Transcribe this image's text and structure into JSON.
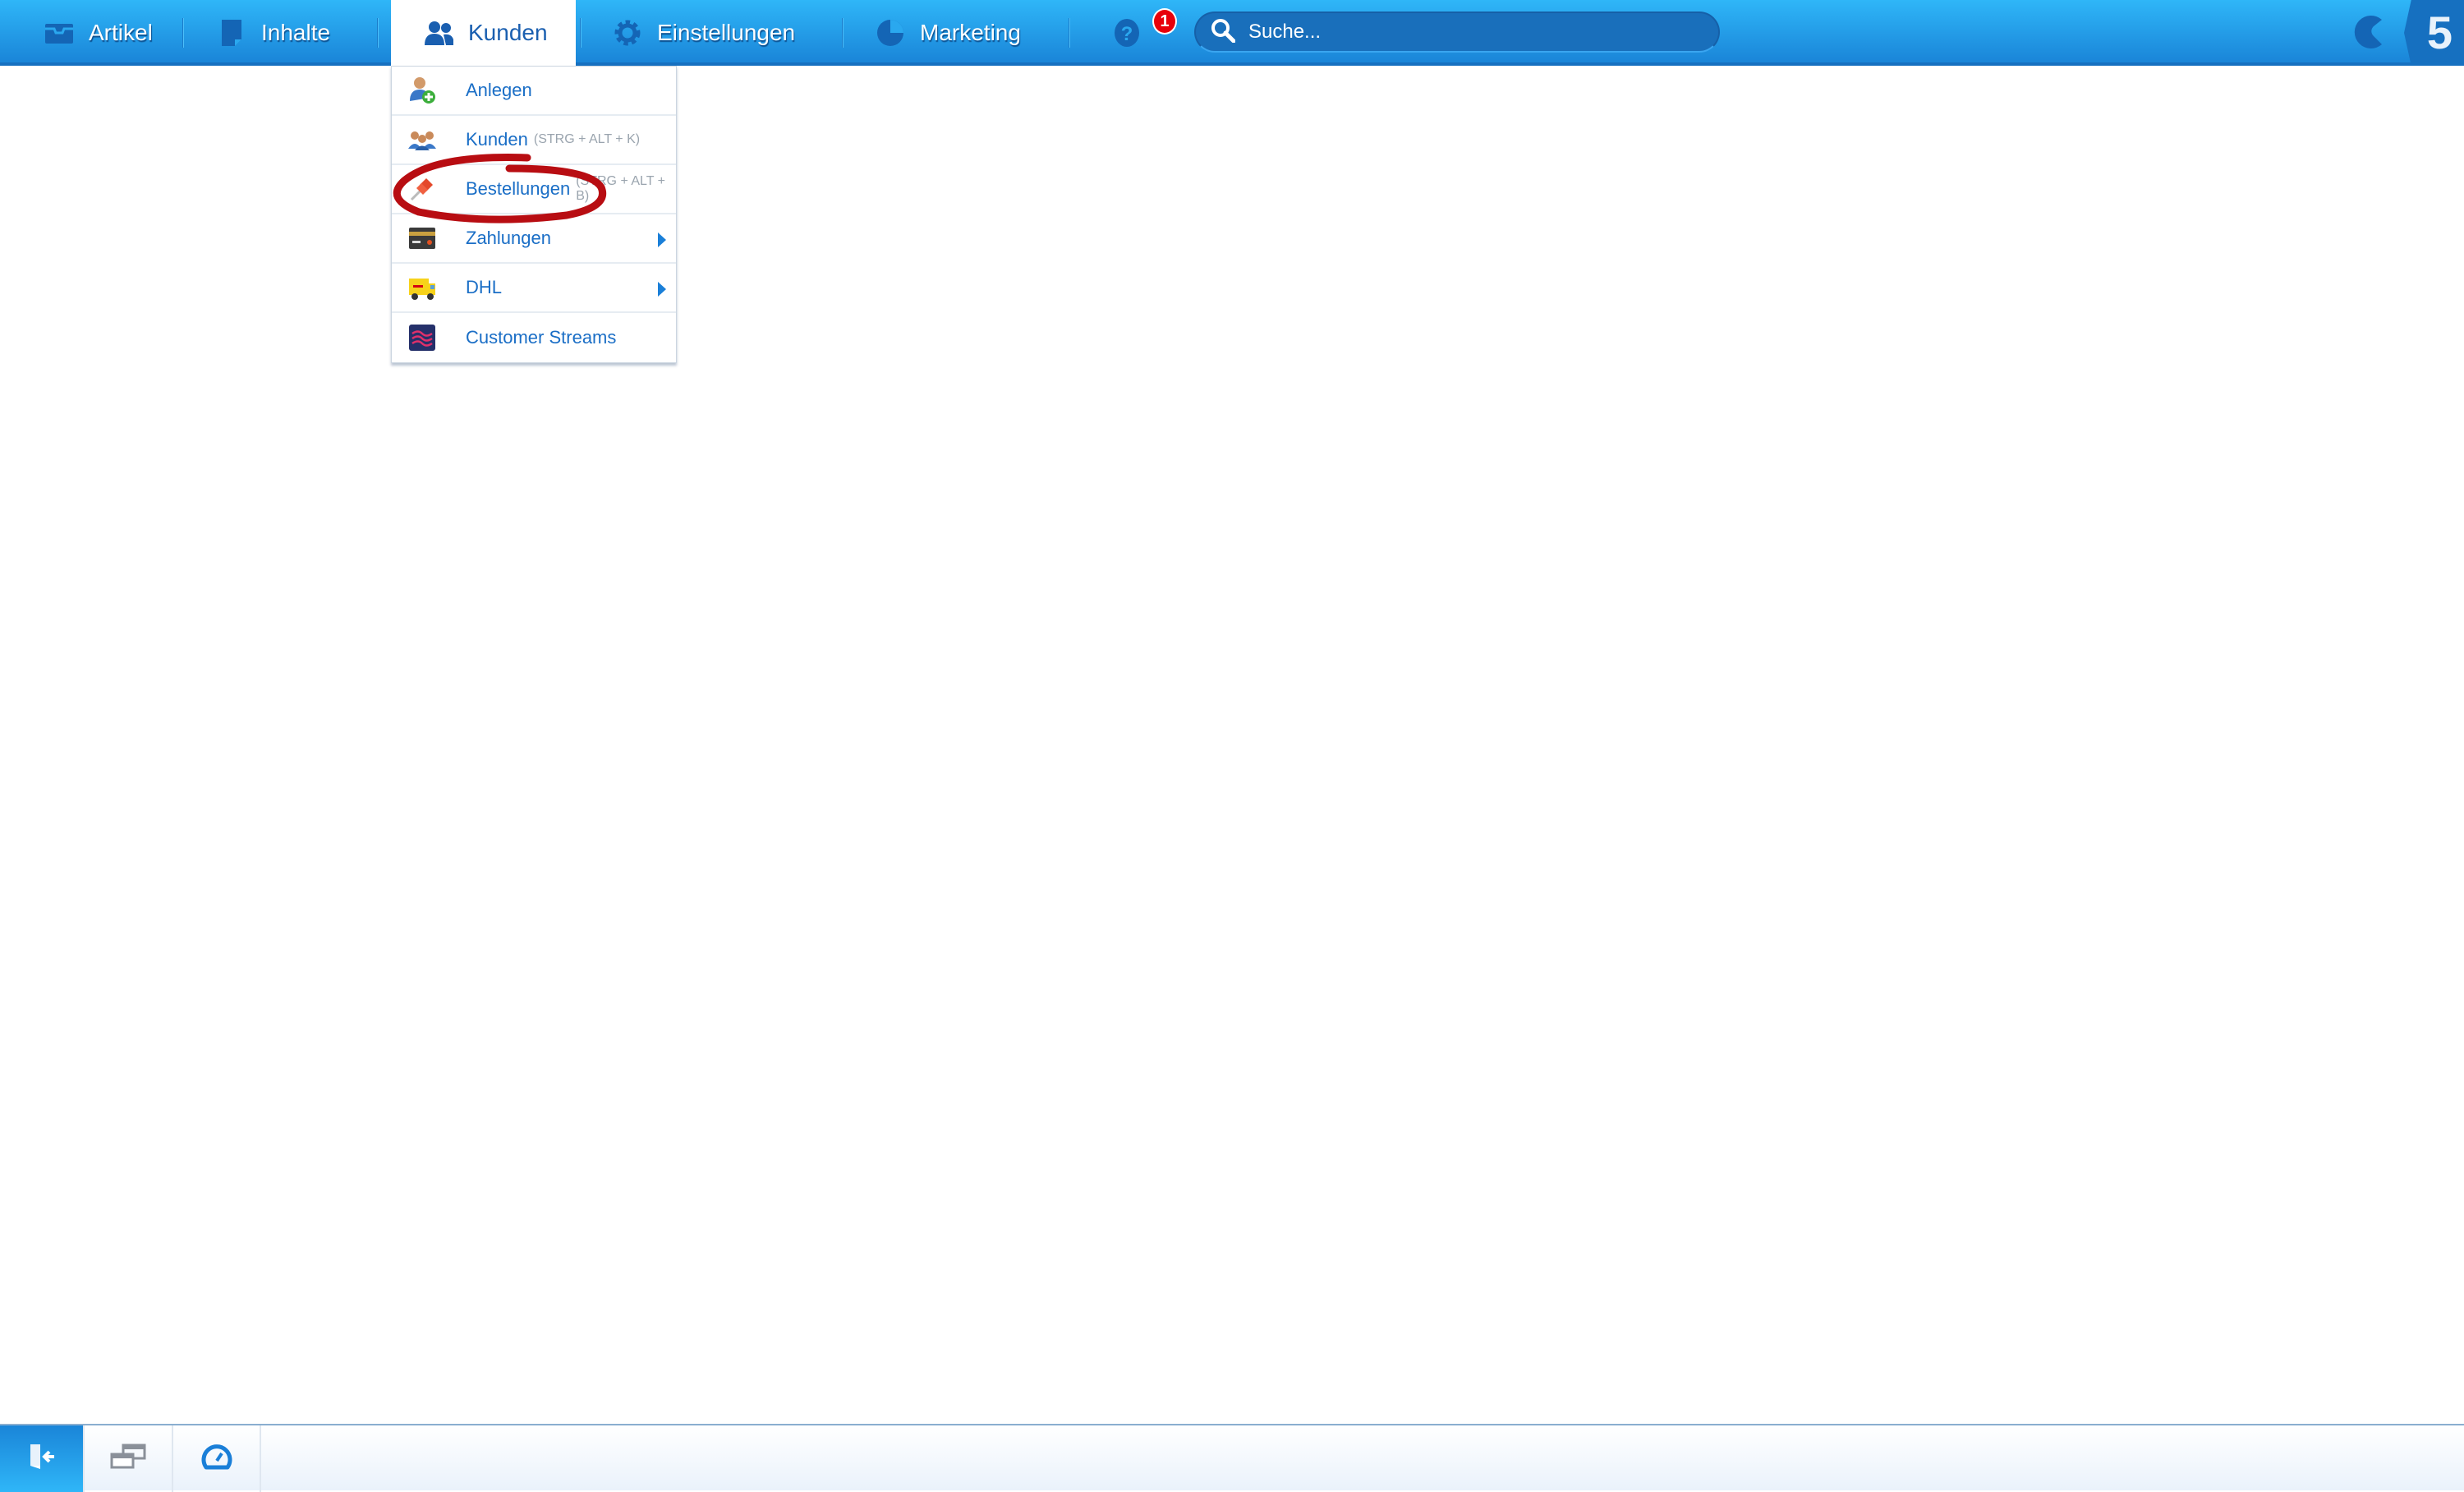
{
  "topbar": {
    "nav": [
      {
        "label": "Artikel",
        "icon": "inbox-icon"
      },
      {
        "label": "Inhalte",
        "icon": "document-icon"
      },
      {
        "label": "Kunden",
        "icon": "users-icon",
        "active": true
      },
      {
        "label": "Einstellungen",
        "icon": "gear-icon"
      },
      {
        "label": "Marketing",
        "icon": "pie-chart-icon"
      }
    ],
    "help_icon": "question-icon",
    "notification_count": "1",
    "search": {
      "placeholder": "Suche...",
      "value": ""
    },
    "colors": {
      "bar": "#2fb6f8",
      "active_text": "#1a5fb0",
      "badge": "#e8000b"
    }
  },
  "menu": {
    "items": [
      {
        "label": "Anlegen",
        "shortcut": "",
        "icon": "user-add-icon",
        "submenu": false
      },
      {
        "label": "Kunden",
        "shortcut": "(STRG + ALT + K)",
        "icon": "customers-icon",
        "submenu": false
      },
      {
        "label": "Bestellungen",
        "shortcut": "(STRG + ALT + B)",
        "icon": "pin-icon",
        "submenu": false,
        "annotated": true
      },
      {
        "label": "Zahlungen",
        "shortcut": "",
        "icon": "credit-card-icon",
        "submenu": true
      },
      {
        "label": "DHL",
        "shortcut": "",
        "icon": "delivery-truck-icon",
        "submenu": true
      },
      {
        "label": "Customer Streams",
        "shortcut": "",
        "icon": "streams-icon",
        "submenu": false
      }
    ]
  },
  "bottombar": {
    "buttons": [
      {
        "icon": "logout-icon",
        "active": true
      },
      {
        "icon": "windows-icon",
        "active": false
      },
      {
        "icon": "speedometer-icon",
        "active": false
      }
    ]
  }
}
